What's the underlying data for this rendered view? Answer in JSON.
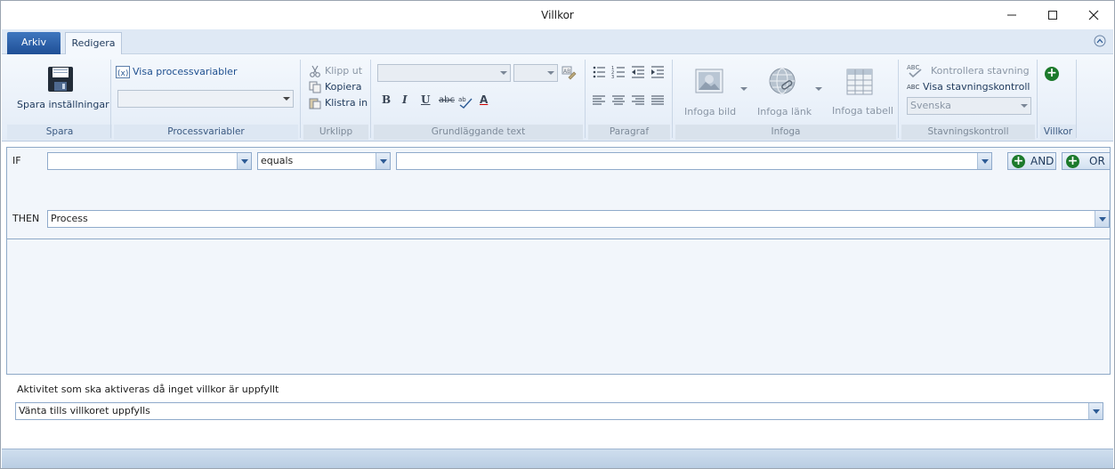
{
  "window": {
    "title": "Villkor"
  },
  "tabs": {
    "file": "Arkiv",
    "edit": "Redigera"
  },
  "ribbon": {
    "save": {
      "button": "Spara inställningar",
      "group": "Spara"
    },
    "process_variables": {
      "show": "Visa processvariabler",
      "group": "Processvariabler"
    },
    "clipboard": {
      "cut": "Klipp ut",
      "copy": "Kopiera",
      "paste": "Klistra in",
      "group": "Urklipp"
    },
    "basic_text": {
      "group": "Grundläggande text",
      "bold": "B",
      "italic": "I",
      "underline": "U",
      "strike": "abc",
      "font_color": "A"
    },
    "paragraph": {
      "group": "Paragraf"
    },
    "insert": {
      "image": "Infoga bild",
      "link": "Infoga länk",
      "table": "Infoga tabell",
      "group": "Infoga"
    },
    "spelling": {
      "check": "Kontrollera stavning",
      "show": "Visa stavningskontroll",
      "language": "Svenska",
      "group": "Stavningskontroll"
    },
    "conditions": {
      "group": "Villkor"
    }
  },
  "condition": {
    "if_label": "IF",
    "operator": "equals",
    "and_button": "AND",
    "or_button": "OR",
    "then_label": "THEN",
    "then_value": "Process"
  },
  "fallback": {
    "label": "Aktivitet som ska aktiveras då inget villkor är uppfyllt",
    "value": "Vänta tills villkoret uppfylls"
  },
  "colors": {
    "accent": "#1f4f96",
    "ribbon_bg": "#e3ecf7",
    "add_green": "#1c7a2b"
  }
}
